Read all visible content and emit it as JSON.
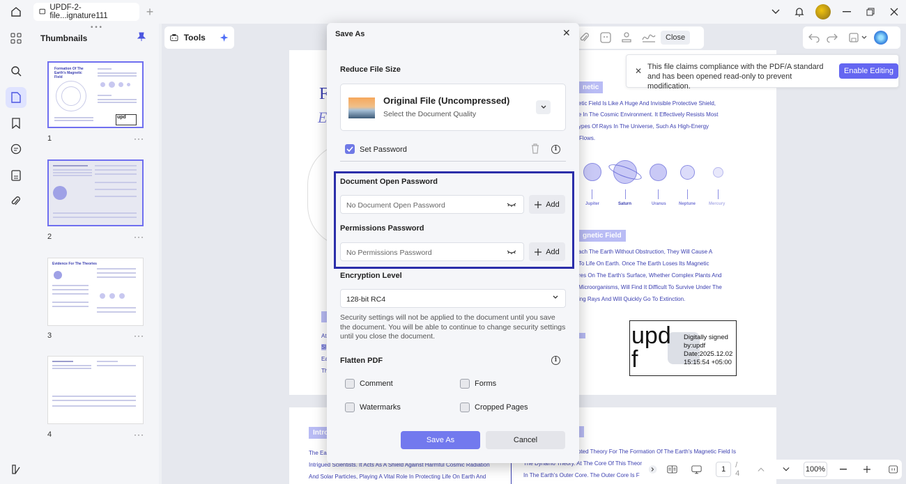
{
  "titlebar": {
    "tab_title": "UPDF-2-file...ignature111",
    "new_tab": "+"
  },
  "thumbnails": {
    "title": "Thumbnails",
    "pages": [
      {
        "num": "1",
        "menu": "···",
        "heading": "Formation Of The Earth's Magnetic Field"
      },
      {
        "num": "2",
        "menu": "···"
      },
      {
        "num": "3",
        "menu": "···",
        "heading": "Evidence For The Theories"
      },
      {
        "num": "4",
        "menu": "···"
      }
    ]
  },
  "toolbar": {
    "tools_label": "Tools",
    "close_label": "Close"
  },
  "notice": {
    "message": "This file claims compliance with the PDF/A standard and has been opened read-only to prevent modification.",
    "button": "Enable Editing"
  },
  "document": {
    "chip_magnetic": "netic",
    "chip_field": "gnetic Field",
    "lines_top": [
      "etic Field Is Like A Huge And Invisible Protective Shield,",
      "le In The Cosmic Environment. It Effectively Resists Most",
      "ypes Of Rays In The Universe, Such As High-Energy",
      "Flows."
    ],
    "planets": [
      "Jupiter",
      "Saturn",
      "Uranus",
      "Neptune",
      "Mercury"
    ],
    "lines_mid": [
      "ach The Earth Without Obstruction, They Will Cause A",
      " To Life On Earth. Once The Earth Loses Its Magnetic",
      "res On The Earth's Surface, Whether Complex Plants And",
      "Microorganisms, Will Find It Difficult To Survive Under The",
      "ing Rays And Will Quickly Go To Extinction."
    ],
    "signature": {
      "big": "upd\nf",
      "text": "Digitally signed by:updf Date:2025.12.02 15:15:54 +05:00"
    },
    "page2_chip": "Intro",
    "page2_left": [
      "The Ea",
      "Intrigued Scientists. It Acts As A Shield Against Harmful Cosmic Radiation",
      "And Solar Particles, Playing A Vital Role In Protecting Life On Earth And"
    ],
    "page2_right": [
      "pted Theory For The Formation Of The Earth's Magnetic Field Is",
      "The Dynamo Theory. At The Core Of This Theor",
      "In The Earth's Outer Core. The Outer Core Is F"
    ],
    "left_fragments": [
      "F",
      "E",
      "At",
      "Sl",
      "Ea",
      "Th"
    ]
  },
  "bottombar": {
    "page_current": "1",
    "page_total": "/ 4",
    "zoom": "100%"
  },
  "save_as": {
    "title": "Save As",
    "reduce_size_label": "Reduce File Size",
    "quality_title": "Original File (Uncompressed)",
    "quality_sub": "Select the Document Quality",
    "set_password_label": "Set Password",
    "open_password_label": "Document Open Password",
    "open_password_placeholder": "No Document Open Password",
    "permissions_label": "Permissions Password",
    "permissions_placeholder": "No Permissions Password",
    "add_label": "Add",
    "encryption_label": "Encryption Level",
    "encryption_value": "128-bit RC4",
    "security_note": "Security settings will not be applied to the document until you save the document. You will be able to continue to change security settings until you close the document.",
    "flatten_label": "Flatten PDF",
    "flatten_options": [
      "Comment",
      "Forms",
      "Watermarks",
      "Cropped Pages"
    ],
    "save_button": "Save As",
    "cancel_button": "Cancel"
  },
  "colors": {
    "accent": "#6466f1",
    "frame": "#2b2eaa"
  }
}
